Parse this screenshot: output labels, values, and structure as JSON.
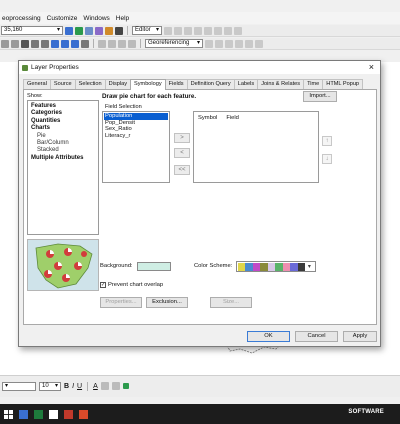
{
  "menu": {
    "items": [
      "eoprocessing",
      "Customize",
      "Windows",
      "Help"
    ]
  },
  "toolbar": {
    "scale_value": "35,160",
    "editor_label": "Editor",
    "georeferencing_label": "Georeferencing"
  },
  "dialog": {
    "title": "Layer Properties",
    "close_glyph": "×",
    "tabs": [
      "General",
      "Source",
      "Selection",
      "Display",
      "Symbology",
      "Fields",
      "Definition Query",
      "Labels",
      "Joins & Relates",
      "Time",
      "HTML Popup"
    ],
    "active_tab": "Symbology",
    "show_label": "Show:",
    "show_items": [
      {
        "label": "Features",
        "bold": true
      },
      {
        "label": "Categories",
        "bold": true
      },
      {
        "label": "Quantities",
        "bold": true
      },
      {
        "label": "Charts",
        "bold": true
      },
      {
        "label": "Pie",
        "bold": false
      },
      {
        "label": "Bar/Column",
        "bold": false
      },
      {
        "label": "Stacked",
        "bold": false
      },
      {
        "label": "Multiple Attributes",
        "bold": true
      }
    ],
    "description": "Draw pie chart for each feature.",
    "import_label": "Import...",
    "field_selection_label": "Field Selection",
    "fields": [
      {
        "label": "Population",
        "selected": true
      },
      {
        "label": "Pop_Densit",
        "selected": false
      },
      {
        "label": "Sex_Ratio",
        "selected": false
      },
      {
        "label": "Literacy_r",
        "selected": false
      }
    ],
    "move_right_label": ">",
    "move_left_label": "<",
    "remove_all_label": "<<",
    "symbol_col": "Symbol",
    "field_col": "Field",
    "up_glyph": "↑",
    "down_glyph": "↓",
    "background_label": "Background:",
    "background_color": "#cfeee4",
    "color_scheme_label": "Color Scheme:",
    "color_scheme_colors": [
      "#e0d64a",
      "#4a8ad0",
      "#c14ac7",
      "#8a8a3a",
      "#d8c8e8",
      "#59b36a",
      "#ef8fb0",
      "#6a6ad8",
      "#3a3a3a"
    ],
    "prevent_overlap_label": "Prevent chart overlap",
    "prevent_overlap_checked": true,
    "check_glyph": "✓",
    "properties_label": "Properties...",
    "exclusion_label": "Exclusion...",
    "size_label": "Size...",
    "ok_label": "OK",
    "cancel_label": "Cancel",
    "apply_label": "Apply"
  },
  "drawing_toolbar": {
    "font_size": "10",
    "bold": "B",
    "italic": "I",
    "underline": "U",
    "font_color_label": "A"
  },
  "taskbar": {
    "tray_text": "SOFTWARE"
  }
}
